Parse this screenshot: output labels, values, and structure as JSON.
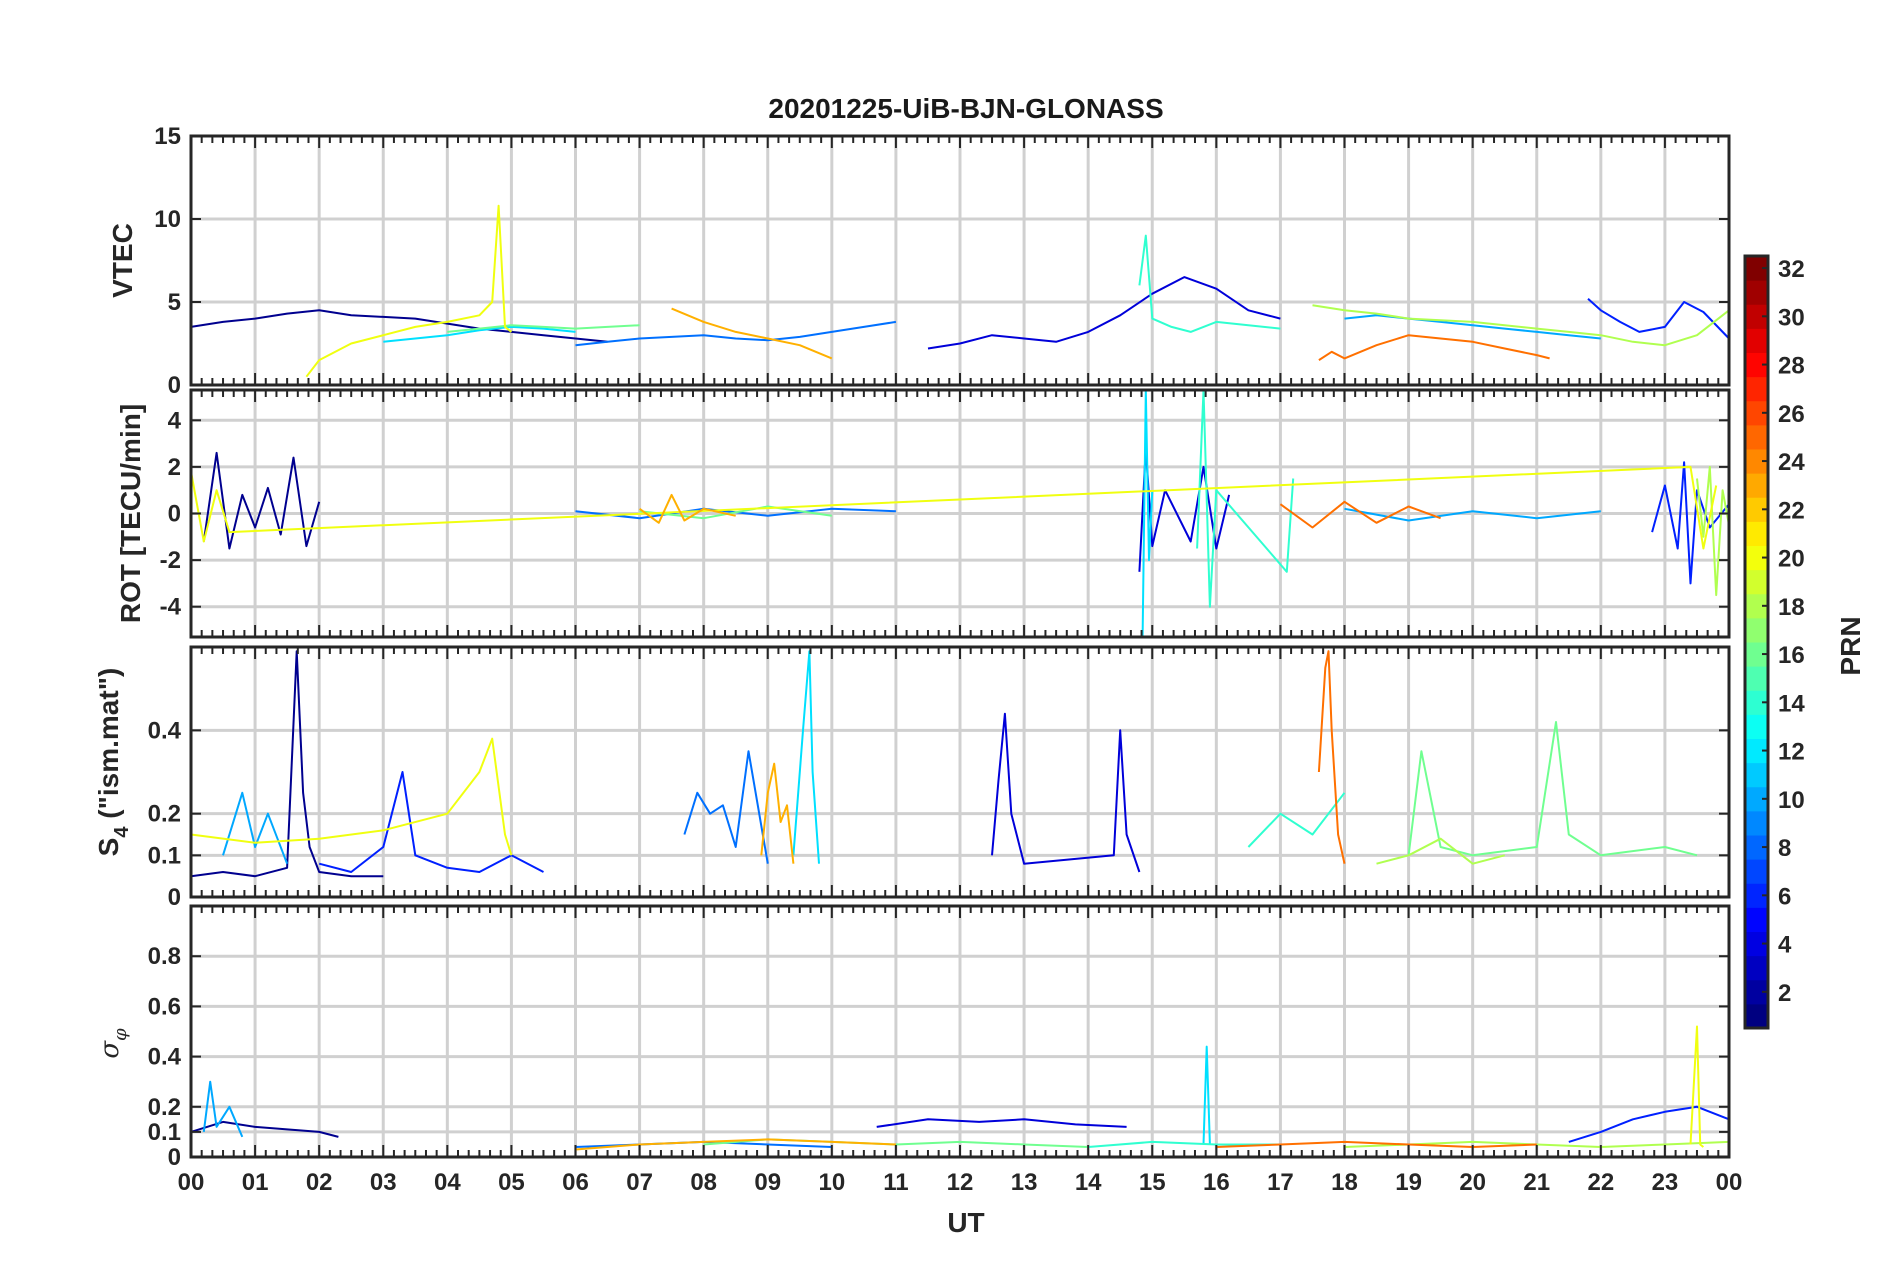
{
  "title": "20201225-UiB-BJN-GLONASS",
  "xlabel": "UT",
  "x_ticks": [
    "00",
    "01",
    "02",
    "03",
    "04",
    "05",
    "06",
    "07",
    "08",
    "09",
    "10",
    "11",
    "12",
    "13",
    "14",
    "15",
    "16",
    "17",
    "18",
    "19",
    "20",
    "21",
    "22",
    "23",
    "00"
  ],
  "colorbar": {
    "label": "PRN",
    "range": [
      1,
      32
    ],
    "ticks": [
      2,
      4,
      6,
      8,
      10,
      12,
      14,
      16,
      18,
      20,
      22,
      24,
      26,
      28,
      30,
      32
    ],
    "colormap": "jet"
  },
  "panels": [
    {
      "id": "vtec",
      "ylabel": "VTEC",
      "ylim": [
        0,
        15
      ],
      "yticks": [
        0,
        5,
        10,
        15
      ],
      "ytick_labels": [
        "0",
        "5",
        "10",
        "15"
      ]
    },
    {
      "id": "rot",
      "ylabel": "ROT [TECU/min]",
      "ylim": [
        -5.3,
        5.3
      ],
      "yticks": [
        -4,
        -2,
        0,
        2,
        4
      ],
      "ytick_labels": [
        "-4",
        "-2",
        "0",
        "2",
        "4"
      ]
    },
    {
      "id": "s4",
      "ylabel_main": "S",
      "ylabel_sub": "4",
      "ylabel_rest": " (\"ism.mat\")",
      "ylim": [
        0,
        0.6
      ],
      "yticks": [
        0,
        0.1,
        0.2,
        0.4
      ],
      "ytick_labels": [
        "0",
        "0.1",
        "0.2",
        "0.4"
      ]
    },
    {
      "id": "sigphi",
      "ylabel_main": "σ",
      "ylabel_sub": "φ",
      "ylim": [
        0,
        1.0
      ],
      "yticks": [
        0,
        0.1,
        0.2,
        0.4,
        0.6,
        0.8
      ],
      "ytick_labels": [
        "0",
        "0.1",
        "0.2",
        "0.4",
        "0.6",
        "0.8"
      ]
    }
  ],
  "chart_data": {
    "type": "line",
    "title": "20201225-UiB-BJN-GLONASS",
    "xlabel": "UT",
    "x_units": "hours UT",
    "xlim": [
      0,
      24
    ],
    "series": [
      {
        "prn": 1,
        "color": "#00008f",
        "vtec": {
          "x": [
            0,
            0.5,
            1,
            1.5,
            2,
            2.5,
            3,
            3.5,
            4,
            4.5,
            5,
            5.5,
            6,
            6.5
          ],
          "y": [
            3.5,
            3.8,
            4.0,
            4.3,
            4.5,
            4.2,
            4.1,
            4.0,
            3.7,
            3.4,
            3.2,
            3.0,
            2.8,
            2.6
          ]
        },
        "rot": {
          "x": [
            0.2,
            0.4,
            0.6,
            0.8,
            1.0,
            1.2,
            1.4,
            1.6,
            1.8,
            2.0
          ],
          "y": [
            -1.2,
            2.6,
            -1.5,
            0.8,
            -0.6,
            1.1,
            -0.9,
            2.4,
            -1.4,
            0.5
          ]
        },
        "s4": {
          "x": [
            0,
            0.5,
            1,
            1.5,
            1.65,
            1.75,
            1.85,
            2,
            2.5,
            3
          ],
          "y": [
            0.05,
            0.06,
            0.05,
            0.07,
            0.59,
            0.25,
            0.12,
            0.06,
            0.05,
            0.05
          ]
        },
        "sigphi": {
          "x": [
            0,
            0.5,
            1,
            1.5,
            2,
            2.3
          ],
          "y": [
            0.1,
            0.14,
            0.12,
            0.11,
            0.1,
            0.08
          ]
        }
      },
      {
        "prn": 3,
        "color": "#0000d9",
        "vtec": {
          "x": [
            11.5,
            12,
            12.5,
            13,
            13.5,
            14,
            14.5,
            15,
            15.5,
            16,
            16.5,
            17
          ],
          "y": [
            2.2,
            2.5,
            3.0,
            2.8,
            2.6,
            3.2,
            4.2,
            5.5,
            6.5,
            5.8,
            4.5,
            4.0
          ]
        },
        "rot": {
          "x": [
            14.8,
            14.9,
            15.0,
            15.2,
            15.6,
            15.8,
            16.0,
            16.2
          ],
          "y": [
            -2.5,
            2.8,
            -1.4,
            1.0,
            -1.2,
            2.0,
            -1.5,
            0.8
          ]
        },
        "s4": {
          "x": [
            12.5,
            12.6,
            12.7,
            12.8,
            13,
            14.4,
            14.5,
            14.6,
            14.8
          ],
          "y": [
            0.1,
            0.28,
            0.44,
            0.2,
            0.08,
            0.1,
            0.4,
            0.15,
            0.06
          ]
        },
        "sigphi": {
          "x": [
            10.7,
            11.5,
            12.3,
            13,
            13.8,
            14.6
          ],
          "y": [
            0.12,
            0.15,
            0.14,
            0.15,
            0.13,
            0.12
          ]
        }
      },
      {
        "prn": 5,
        "color": "#0020ff",
        "vtec": {
          "x": [
            21.8,
            22,
            22.3,
            22.6,
            23,
            23.3,
            23.6,
            24
          ],
          "y": [
            5.2,
            4.5,
            3.8,
            3.2,
            3.5,
            5.0,
            4.4,
            2.8
          ]
        },
        "rot": {
          "x": [
            22.8,
            23,
            23.2,
            23.3,
            23.4,
            23.5,
            23.7,
            24
          ],
          "y": [
            -0.8,
            1.2,
            -1.5,
            2.2,
            -3.0,
            1.0,
            -0.6,
            0.4
          ]
        },
        "s4": {
          "x": [
            2,
            2.5,
            3,
            3.3,
            3.5,
            4,
            4.5,
            5,
            5.5
          ],
          "y": [
            0.08,
            0.06,
            0.12,
            0.3,
            0.1,
            0.07,
            0.06,
            0.1,
            0.06
          ]
        },
        "sigphi": {
          "x": [
            21.5,
            22,
            22.5,
            23,
            23.5,
            24
          ],
          "y": [
            0.06,
            0.1,
            0.15,
            0.18,
            0.2,
            0.15
          ]
        }
      },
      {
        "prn": 8,
        "color": "#0070ff",
        "vtec": {
          "x": [
            6,
            6.5,
            7,
            7.5,
            8,
            8.5,
            9,
            9.5,
            10,
            10.5,
            11
          ],
          "y": [
            2.4,
            2.6,
            2.8,
            2.9,
            3.0,
            2.8,
            2.7,
            2.9,
            3.2,
            3.5,
            3.8
          ]
        },
        "rot": {
          "x": [
            6,
            7,
            8,
            9,
            10,
            11
          ],
          "y": [
            0.1,
            -0.2,
            0.2,
            -0.1,
            0.2,
            0.1
          ]
        },
        "s4": {
          "x": [
            7.7,
            7.9,
            8.1,
            8.3,
            8.5,
            8.7,
            9
          ],
          "y": [
            0.15,
            0.25,
            0.2,
            0.22,
            0.12,
            0.35,
            0.08
          ]
        },
        "sigphi": {
          "x": [
            6,
            7,
            8,
            9,
            10
          ],
          "y": [
            0.04,
            0.05,
            0.06,
            0.05,
            0.04
          ]
        }
      },
      {
        "prn": 10,
        "color": "#00a8ff",
        "vtec": {
          "x": [
            18,
            18.5,
            19,
            19.5,
            20,
            20.5,
            21,
            21.5,
            22
          ],
          "y": [
            4.0,
            4.2,
            4.0,
            3.8,
            3.6,
            3.4,
            3.2,
            3.0,
            2.8
          ]
        },
        "rot": {
          "x": [
            18,
            19,
            20,
            21,
            22
          ],
          "y": [
            0.2,
            -0.3,
            0.1,
            -0.2,
            0.1
          ]
        },
        "s4": {
          "x": [
            0.5,
            0.8,
            1,
            1.2,
            1.5
          ],
          "y": [
            0.1,
            0.25,
            0.12,
            0.2,
            0.08
          ]
        },
        "sigphi": {
          "x": [
            0.2,
            0.3,
            0.4,
            0.6,
            0.8
          ],
          "y": [
            0.1,
            0.3,
            0.12,
            0.2,
            0.08
          ]
        }
      },
      {
        "prn": 12,
        "color": "#00e0ff",
        "vtec": {
          "x": [
            3,
            3.5,
            4,
            4.5,
            5,
            5.5,
            6
          ],
          "y": [
            2.6,
            2.8,
            3.0,
            3.3,
            3.5,
            3.4,
            3.2
          ]
        },
        "rot": {
          "x": [
            14.85,
            14.9,
            14.95,
            15.0
          ],
          "y": [
            -5.3,
            5.3,
            -2.0,
            1.0
          ]
        },
        "s4": {
          "x": [
            9.4,
            9.55,
            9.65,
            9.7,
            9.8
          ],
          "y": [
            0.1,
            0.4,
            0.59,
            0.3,
            0.08
          ]
        },
        "sigphi": {
          "x": [
            15.8,
            15.85,
            15.9
          ],
          "y": [
            0.05,
            0.44,
            0.05
          ]
        }
      },
      {
        "prn": 14,
        "color": "#30ffd0",
        "vtec": {
          "x": [
            14.8,
            14.9,
            15,
            15.3,
            15.6,
            16,
            16.5,
            17
          ],
          "y": [
            6.0,
            9.0,
            4.0,
            3.5,
            3.2,
            3.8,
            3.6,
            3.4
          ]
        },
        "rot": {
          "x": [
            15.7,
            15.8,
            15.9,
            16.0,
            17.1,
            17.2
          ],
          "y": [
            -1.5,
            5.3,
            -4.0,
            1.0,
            -2.5,
            1.5
          ]
        },
        "s4": {
          "x": [
            16.5,
            17,
            17.5,
            18
          ],
          "y": [
            0.12,
            0.2,
            0.15,
            0.25
          ]
        },
        "sigphi": {
          "x": [
            14,
            15,
            16,
            17
          ],
          "y": [
            0.04,
            0.06,
            0.05,
            0.05
          ]
        }
      },
      {
        "prn": 16,
        "color": "#70ff90",
        "vtec": {
          "x": [
            4,
            4.5,
            5,
            5.5,
            6,
            6.5,
            7
          ],
          "y": [
            3.2,
            3.4,
            3.6,
            3.5,
            3.4,
            3.5,
            3.6
          ]
        },
        "rot": {
          "x": [
            7,
            8,
            9,
            10
          ],
          "y": [
            0.1,
            -0.2,
            0.3,
            -0.1
          ]
        },
        "s4": {
          "x": [
            19,
            19.2,
            19.5,
            20,
            21,
            21.3,
            21.5,
            22,
            23,
            23.5
          ],
          "y": [
            0.1,
            0.35,
            0.12,
            0.1,
            0.12,
            0.42,
            0.15,
            0.1,
            0.12,
            0.1
          ]
        },
        "sigphi": {
          "x": [
            8,
            9,
            10,
            11,
            12,
            13,
            14
          ],
          "y": [
            0.05,
            0.07,
            0.06,
            0.05,
            0.06,
            0.05,
            0.04
          ]
        }
      },
      {
        "prn": 18,
        "color": "#b0ff50",
        "vtec": {
          "x": [
            17.5,
            18,
            18.5,
            19,
            19.5,
            20,
            20.5,
            21,
            21.5,
            22,
            22.5,
            23,
            23.5,
            24
          ],
          "y": [
            4.8,
            4.5,
            4.3,
            4.0,
            3.9,
            3.8,
            3.6,
            3.4,
            3.2,
            3.0,
            2.6,
            2.4,
            3.0,
            4.5
          ]
        },
        "rot": {
          "x": [
            23.5,
            23.6,
            23.7,
            23.8,
            23.9,
            24
          ],
          "y": [
            1.5,
            -1.0,
            2.0,
            -3.5,
            1.0,
            -0.5
          ]
        },
        "s4": {
          "x": [
            18.5,
            19,
            19.5,
            20,
            20.5
          ],
          "y": [
            0.08,
            0.1,
            0.14,
            0.08,
            0.1
          ]
        },
        "sigphi": {
          "x": [
            18,
            19,
            20,
            21,
            22,
            23,
            24
          ],
          "y": [
            0.04,
            0.05,
            0.06,
            0.05,
            0.04,
            0.05,
            0.06
          ]
        }
      },
      {
        "prn": 20,
        "color": "#f0ff10",
        "vtec": {
          "x": [
            1.8,
            2,
            2.5,
            3,
            3.5,
            4,
            4.5,
            4.7,
            4.8,
            4.9,
            5
          ],
          "y": [
            0.5,
            1.5,
            2.5,
            3.0,
            3.5,
            3.8,
            4.2,
            5.0,
            10.8,
            3.5,
            3.2
          ]
        },
        "rot": {
          "x": [
            0,
            0.2,
            0.4,
            0.6,
            23.4,
            23.6,
            23.8
          ],
          "y": [
            1.8,
            -1.2,
            1.0,
            -0.8,
            2.0,
            -1.5,
            1.2
          ]
        },
        "s4": {
          "x": [
            0,
            1,
            2,
            3,
            4,
            4.5,
            4.7,
            4.9,
            5
          ],
          "y": [
            0.15,
            0.13,
            0.14,
            0.16,
            0.2,
            0.3,
            0.38,
            0.15,
            0.1
          ]
        },
        "sigphi": {
          "x": [
            23.4,
            23.5,
            23.55,
            23.6
          ],
          "y": [
            0.05,
            0.52,
            0.05,
            0.04
          ]
        }
      },
      {
        "prn": 22,
        "color": "#ffb000",
        "vtec": {
          "x": [
            7.5,
            8,
            8.5,
            9,
            9.5,
            10
          ],
          "y": [
            4.6,
            3.8,
            3.2,
            2.8,
            2.4,
            1.6
          ]
        },
        "rot": {
          "x": [
            7,
            7.3,
            7.5,
            7.7,
            8,
            8.5
          ],
          "y": [
            0.2,
            -0.4,
            0.8,
            -0.3,
            0.2,
            -0.1
          ]
        },
        "s4": {
          "x": [
            8.9,
            9,
            9.1,
            9.2,
            9.3,
            9.4
          ],
          "y": [
            0.1,
            0.25,
            0.32,
            0.18,
            0.22,
            0.08
          ]
        },
        "sigphi": {
          "x": [
            6,
            7,
            8,
            9,
            10,
            11
          ],
          "y": [
            0.03,
            0.05,
            0.06,
            0.07,
            0.06,
            0.05
          ]
        }
      },
      {
        "prn": 24,
        "color": "#ff7000",
        "vtec": {
          "x": [
            17.6,
            17.8,
            18,
            18.5,
            19,
            19.5,
            20,
            20.5,
            21,
            21.2
          ],
          "y": [
            1.5,
            2.0,
            1.6,
            2.4,
            3.0,
            2.8,
            2.6,
            2.2,
            1.8,
            1.6
          ]
        },
        "rot": {
          "x": [
            17,
            17.5,
            18,
            18.5,
            19,
            19.5
          ],
          "y": [
            0.4,
            -0.6,
            0.5,
            -0.4,
            0.3,
            -0.2
          ]
        },
        "s4": {
          "x": [
            17.6,
            17.7,
            17.75,
            17.8,
            17.9,
            18
          ],
          "y": [
            0.3,
            0.55,
            0.59,
            0.4,
            0.15,
            0.08
          ]
        },
        "sigphi": {
          "x": [
            16,
            17,
            18,
            19,
            20,
            21
          ],
          "y": [
            0.04,
            0.05,
            0.06,
            0.05,
            0.04,
            0.05
          ]
        }
      }
    ]
  }
}
